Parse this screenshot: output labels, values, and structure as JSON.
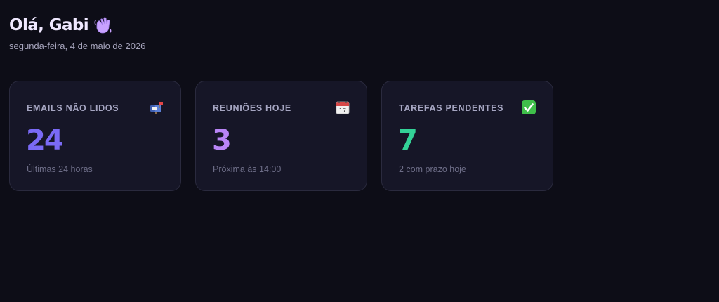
{
  "header": {
    "greeting": "Olá, Gabi",
    "wave_icon": "waving-hand-icon",
    "date": "segunda-feira, 4 de maio de 2026"
  },
  "cards": [
    {
      "label": "EMAILS NÃO LIDOS",
      "icon": "mailbox-icon",
      "value": "24",
      "subtitle": "Últimas 24 horas",
      "color": "#7a6af5"
    },
    {
      "label": "REUNIÕES HOJE",
      "icon": "calendar-icon",
      "value": "3",
      "subtitle": "Próxima às 14:00",
      "color": "#b985f6"
    },
    {
      "label": "TAREFAS PENDENTES",
      "icon": "check-mark-icon",
      "value": "7",
      "subtitle": "2 com prazo hoje",
      "color": "#33d297"
    }
  ],
  "theme": {
    "background": "#0d0d17",
    "card_background": "#161627",
    "card_border": "#2a2a3e"
  }
}
